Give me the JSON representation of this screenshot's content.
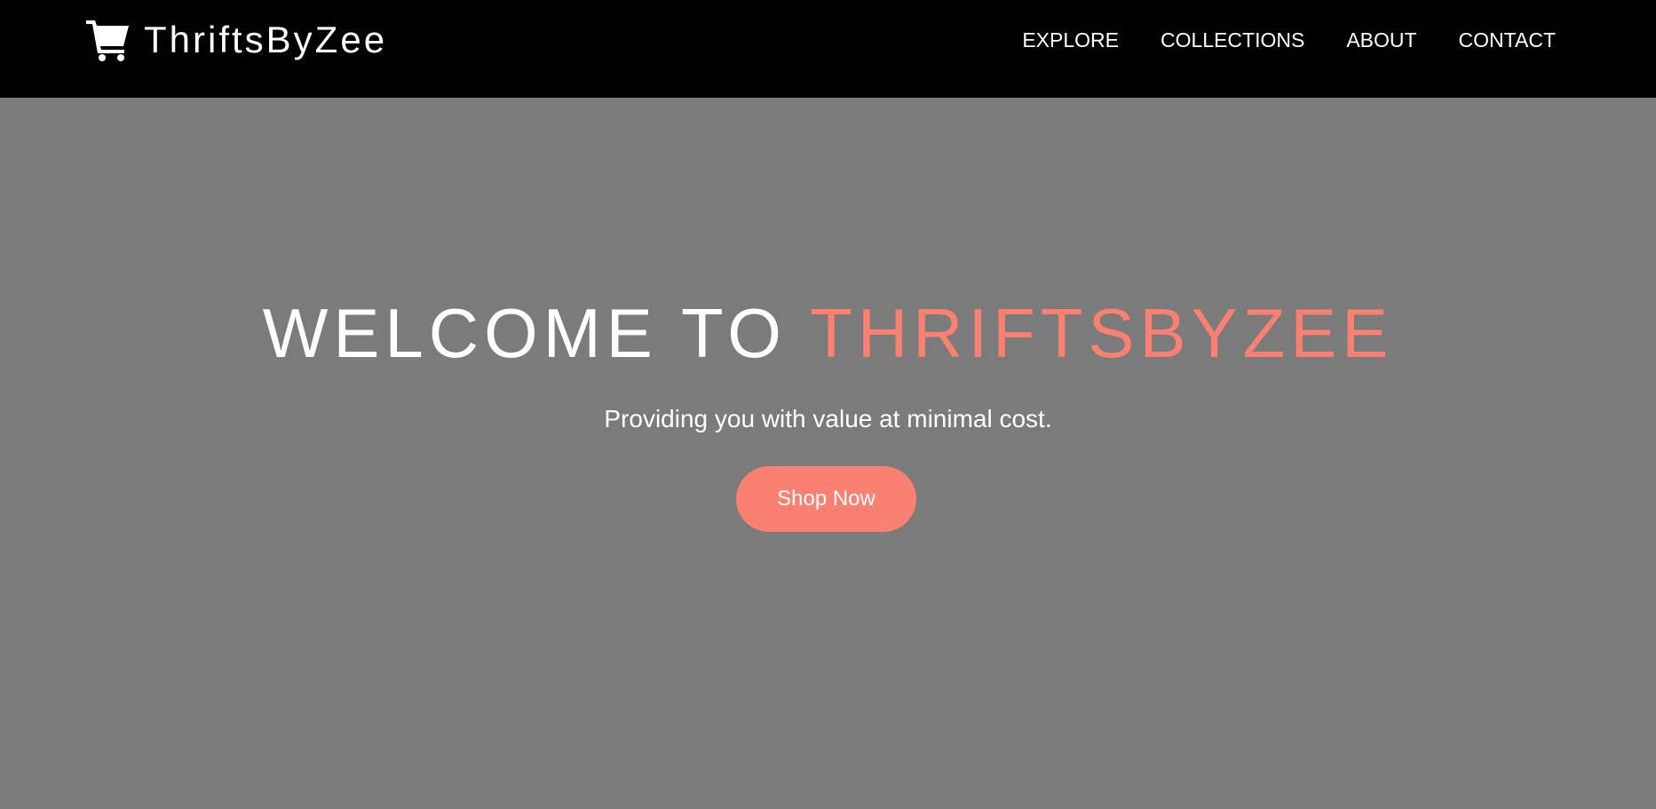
{
  "navbar": {
    "brand": {
      "icon": "shopping-cart-icon",
      "name": "ThriftsByZee"
    },
    "links": [
      {
        "label": "EXPLORE"
      },
      {
        "label": "COLLECTIONS"
      },
      {
        "label": "ABOUT"
      },
      {
        "label": "CONTACT"
      }
    ]
  },
  "hero": {
    "title_prefix": "WELCOME TO",
    "title_accent": "THRIFTSBYZEE",
    "subtitle": "Providing you with value at minimal cost.",
    "cta_label": "Shop Now"
  },
  "colors": {
    "navbar_bg": "#000000",
    "hero_bg": "#7b7b7b",
    "accent": "#fa8072",
    "text": "#ffffff"
  }
}
